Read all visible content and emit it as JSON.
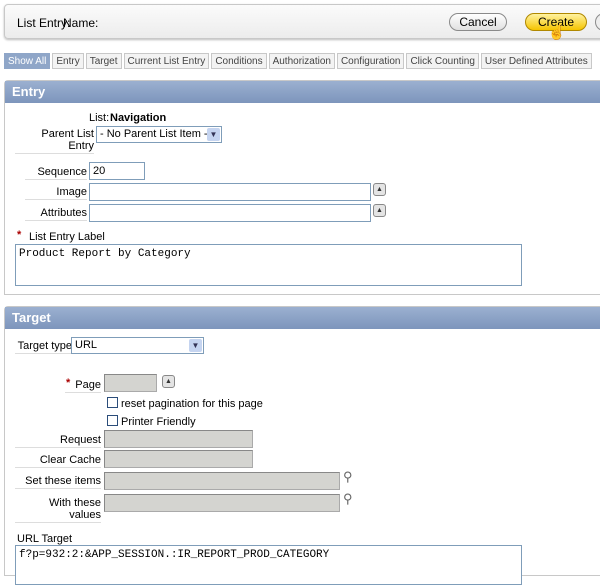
{
  "header": {
    "list_entry_label": "List Entry:",
    "name_label": "Name:",
    "cancel": "Cancel",
    "create": "Create"
  },
  "tabs": [
    "Show All",
    "Entry",
    "Target",
    "Current List Entry",
    "Conditions",
    "Authorization",
    "Configuration",
    "Click Counting",
    "User Defined Attributes"
  ],
  "entry": {
    "title": "Entry",
    "list_label": "List:",
    "list_value": "Navigation",
    "parent_label": "Parent List Entry",
    "parent_value": "- No Parent List Item -",
    "sequence_label": "Sequence",
    "sequence_value": "20",
    "image_label": "Image",
    "image_value": "",
    "attributes_label": "Attributes",
    "attributes_value": "",
    "required_marker": "*",
    "entry_label_label": "List Entry Label",
    "entry_label_value": "Product Report by Category"
  },
  "target": {
    "title": "Target",
    "type_label": "Target type",
    "type_value": "URL",
    "required_marker": "*",
    "page_label": "Page",
    "reset_label": "reset pagination for this page",
    "printer_label": "Printer Friendly",
    "request_label": "Request",
    "clear_cache_label": "Clear Cache",
    "set_items_label": "Set these items",
    "with_values_label": "With these values",
    "url_target_label": "URL Target",
    "url_target_value": "f?p=932:2:&APP_SESSION.:IR_REPORT_PROD_CATEGORY"
  }
}
